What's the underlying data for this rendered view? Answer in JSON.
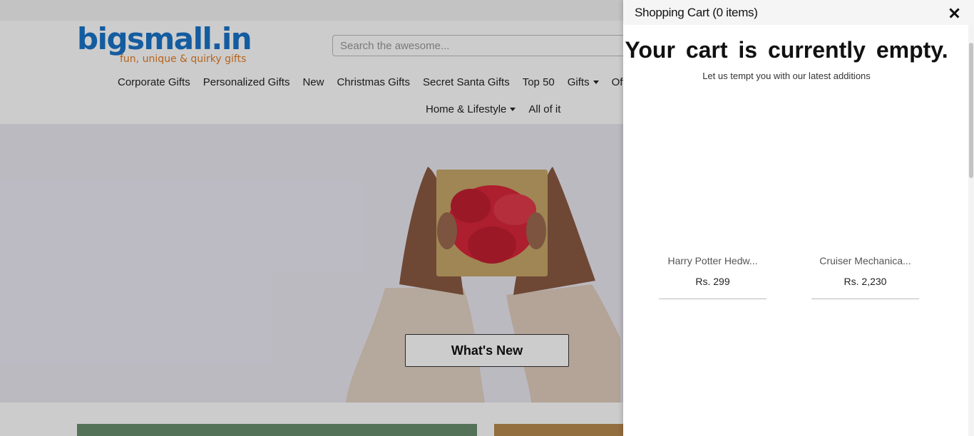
{
  "site": {
    "logo_main": "bigsmall.in",
    "logo_tagline": "fun, unique & quirky gifts",
    "search_placeholder": "Search the awesome...",
    "nav_row1": [
      "Corporate Gifts",
      "Personalized Gifts",
      "New",
      "Christmas Gifts",
      "Secret Santa Gifts",
      "Top 50",
      "Gifts",
      "Official Me"
    ],
    "nav_row2": [
      "Home & Lifestyle",
      "All of it"
    ],
    "hero_button": "What's New"
  },
  "cart": {
    "title": "Shopping Cart (0 items)",
    "empty_title": "Your cart is currently empty.",
    "empty_subtitle": "Let us tempt you with our latest additions",
    "products": [
      {
        "name": "Harry Potter Hedw...",
        "price": "Rs. 299"
      },
      {
        "name": "Cruiser Mechanica...",
        "price": "Rs. 2,230"
      }
    ]
  },
  "colors": {
    "logo_blue": "#1a73c8",
    "logo_orange": "#e67e22",
    "ribbon_red": "#d9263a"
  }
}
